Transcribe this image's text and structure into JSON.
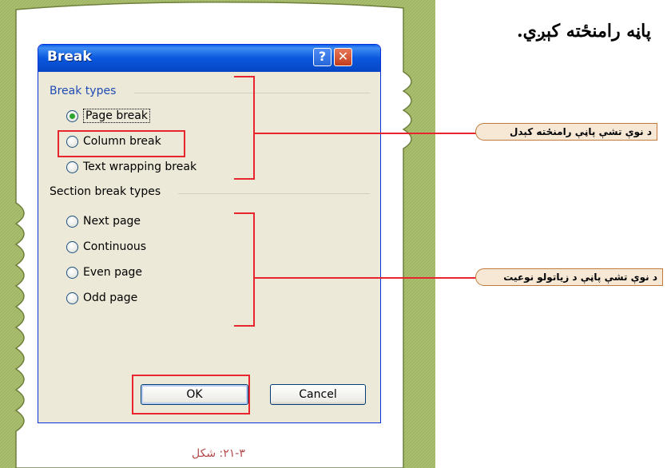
{
  "heading": "پاڼه رامنځته کېږي.",
  "dialog": {
    "title": "Break",
    "help_glyph": "?",
    "close_glyph": "✕",
    "break_types_label": "Break types",
    "break_types": [
      {
        "label": "Page break",
        "checked": true
      },
      {
        "label": "Column break",
        "checked": false
      },
      {
        "label": "Text wrapping break",
        "checked": false
      }
    ],
    "section_label": "Section break types",
    "section_types": [
      {
        "label": "Next page",
        "checked": false
      },
      {
        "label": "Continuous",
        "checked": false
      },
      {
        "label": "Even page",
        "checked": false
      },
      {
        "label": "Odd page",
        "checked": false
      }
    ],
    "ok_label": "OK",
    "cancel_label": "Cancel"
  },
  "annotations": {
    "page_break_note": "د نوې تشې پاڼې رامنځته کېدل",
    "section_note": "د نوې تشې پاڼې د زیاتولو نوعیت"
  },
  "caption": "۲۱-۳: شکل",
  "colors": {
    "frame_green": "#a9bd6e",
    "annotation_red": "#e8242c",
    "titlebar_blue": "#0a58de"
  }
}
